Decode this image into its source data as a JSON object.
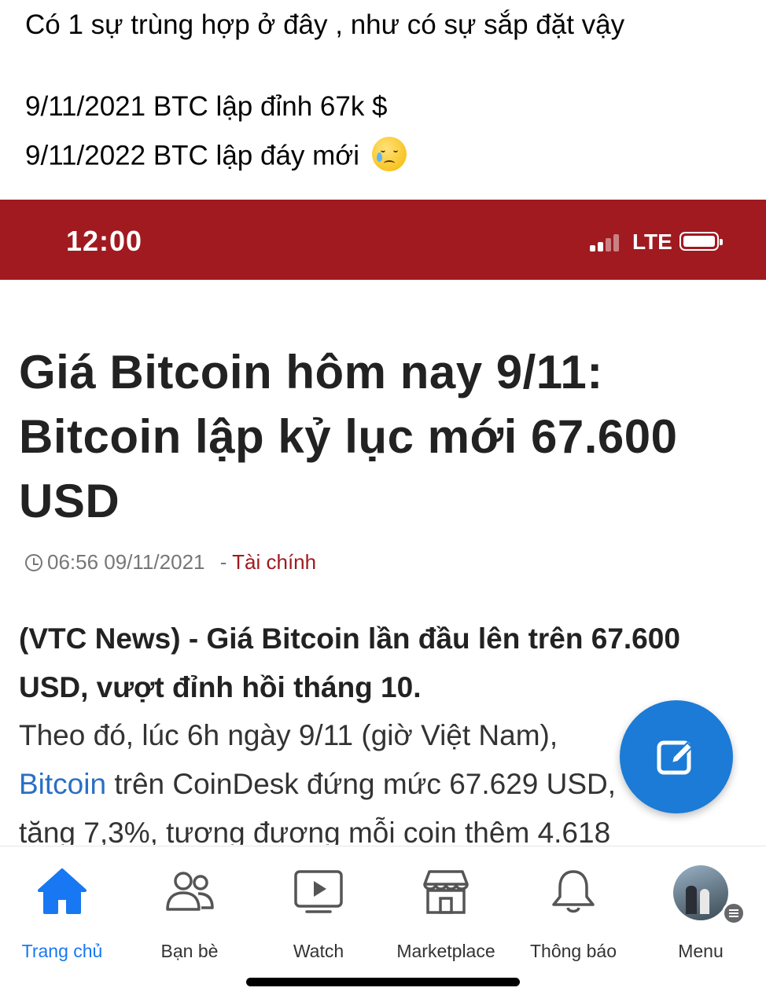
{
  "post": {
    "line1": "Có 1 sự trùng hợp ở đây , như có sự sắp đặt vậy",
    "line2": "9/11/2021 BTC lập đỉnh 67k $",
    "line3": "9/11/2022 BTC lập đáy mới",
    "line3_emoji": "crying-face"
  },
  "statusbar": {
    "time": "12:00",
    "network": "LTE",
    "bg_color": "#a01a20"
  },
  "article": {
    "headline": "Giá Bitcoin hôm nay 9/11: Bitcoin lập kỷ lục mới 67.600 USD",
    "timestamp": "06:56 09/11/2021",
    "separator": "-",
    "category": "Tài chính",
    "lead": "(VTC News) - Giá Bitcoin lần đầu lên trên 67.600 USD, vượt đỉnh hồi tháng 10.",
    "body_line1": "Theo đó, lúc 6h ngày 9/11 (giờ Việt Nam),",
    "body_link": "Bitcoin",
    "body_line2_rest": " trên CoinDesk đứng mức 67.629 USD,",
    "body_line3": "tăng 7,3%, tương đương mỗi coin thêm 4.618"
  },
  "fab": {
    "icon": "edit-icon",
    "color": "#1b7bd6"
  },
  "tabbar": {
    "active_color": "#1877f2",
    "items": [
      {
        "label": "Trang chủ",
        "icon": "home-icon"
      },
      {
        "label": "Bạn bè",
        "icon": "friends-icon"
      },
      {
        "label": "Watch",
        "icon": "watch-icon"
      },
      {
        "label": "Marketplace",
        "icon": "marketplace-icon"
      },
      {
        "label": "Thông báo",
        "icon": "bell-icon"
      },
      {
        "label": "Menu",
        "icon": "avatar-menu-icon"
      }
    ]
  }
}
